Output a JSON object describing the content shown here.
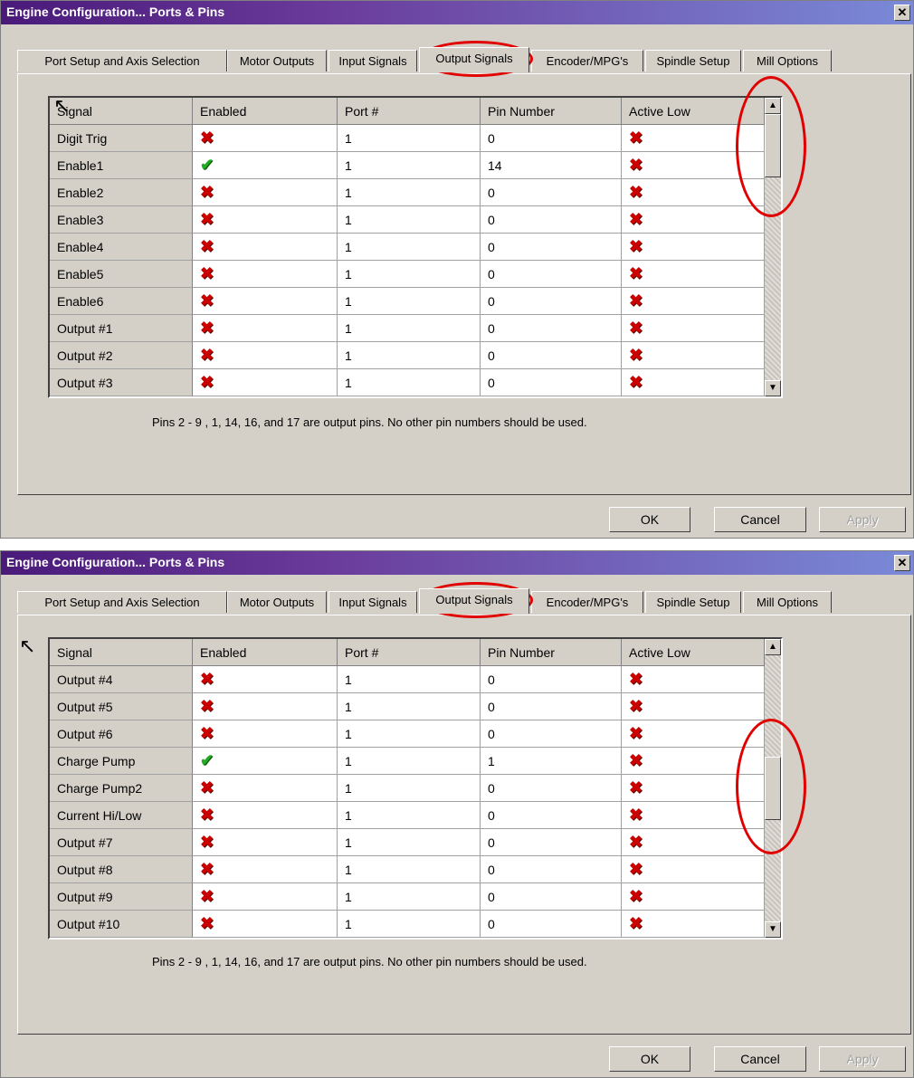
{
  "dialogs": [
    {
      "title": "Engine Configuration... Ports & Pins",
      "close_glyph": "✕",
      "tabs": [
        "Port Setup and Axis Selection",
        "Motor Outputs",
        "Input Signals",
        "Output Signals",
        "Encoder/MPG's",
        "Spindle Setup",
        "Mill Options"
      ],
      "active_tab": "Output Signals",
      "columns": [
        "Signal",
        "Enabled",
        "Port #",
        "Pin Number",
        "Active Low"
      ],
      "rows": [
        {
          "signal": "Digit  Trig",
          "enabled": "x",
          "port": "1",
          "pin": "0",
          "active_low": "x"
        },
        {
          "signal": "Enable1",
          "enabled": "check",
          "port": "1",
          "pin": "14",
          "active_low": "x"
        },
        {
          "signal": "Enable2",
          "enabled": "x",
          "port": "1",
          "pin": "0",
          "active_low": "x"
        },
        {
          "signal": "Enable3",
          "enabled": "x",
          "port": "1",
          "pin": "0",
          "active_low": "x"
        },
        {
          "signal": "Enable4",
          "enabled": "x",
          "port": "1",
          "pin": "0",
          "active_low": "x"
        },
        {
          "signal": "Enable5",
          "enabled": "x",
          "port": "1",
          "pin": "0",
          "active_low": "x"
        },
        {
          "signal": "Enable6",
          "enabled": "x",
          "port": "1",
          "pin": "0",
          "active_low": "x"
        },
        {
          "signal": "Output #1",
          "enabled": "x",
          "port": "1",
          "pin": "0",
          "active_low": "x"
        },
        {
          "signal": "Output #2",
          "enabled": "x",
          "port": "1",
          "pin": "0",
          "active_low": "x"
        },
        {
          "signal": "Output #3",
          "enabled": "x",
          "port": "1",
          "pin": "0",
          "active_low": "x"
        }
      ],
      "scroll_position": 0.0,
      "note": "Pins 2 - 9 , 1, 14, 16, and 17 are output pins. No  other pin numbers should be used.",
      "buttons": {
        "ok": "OK",
        "cancel": "Cancel",
        "apply": "Apply"
      }
    },
    {
      "title": "Engine Configuration... Ports & Pins",
      "close_glyph": "✕",
      "tabs": [
        "Port Setup and Axis Selection",
        "Motor Outputs",
        "Input Signals",
        "Output Signals",
        "Encoder/MPG's",
        "Spindle Setup",
        "Mill Options"
      ],
      "active_tab": "Output Signals",
      "columns": [
        "Signal",
        "Enabled",
        "Port #",
        "Pin Number",
        "Active Low"
      ],
      "rows": [
        {
          "signal": "Output #4",
          "enabled": "x",
          "port": "1",
          "pin": "0",
          "active_low": "x"
        },
        {
          "signal": "Output #5",
          "enabled": "x",
          "port": "1",
          "pin": "0",
          "active_low": "x"
        },
        {
          "signal": "Output #6",
          "enabled": "x",
          "port": "1",
          "pin": "0",
          "active_low": "x"
        },
        {
          "signal": "Charge Pump",
          "enabled": "check",
          "port": "1",
          "pin": "1",
          "active_low": "x"
        },
        {
          "signal": "Charge Pump2",
          "enabled": "x",
          "port": "1",
          "pin": "0",
          "active_low": "x"
        },
        {
          "signal": "Current Hi/Low",
          "enabled": "x",
          "port": "1",
          "pin": "0",
          "active_low": "x"
        },
        {
          "signal": "Output #7",
          "enabled": "x",
          "port": "1",
          "pin": "0",
          "active_low": "x"
        },
        {
          "signal": "Output #8",
          "enabled": "x",
          "port": "1",
          "pin": "0",
          "active_low": "x"
        },
        {
          "signal": "Output #9",
          "enabled": "x",
          "port": "1",
          "pin": "0",
          "active_low": "x"
        },
        {
          "signal": "Output #10",
          "enabled": "x",
          "port": "1",
          "pin": "0",
          "active_low": "x"
        }
      ],
      "scroll_position": 0.5,
      "note": "Pins 2 - 9 , 1, 14, 16, and 17 are output pins. No  other pin numbers should be used.",
      "buttons": {
        "ok": "OK",
        "cancel": "Cancel",
        "apply": "Apply"
      }
    }
  ],
  "icons": {
    "x": "red-x-icon",
    "check": "green-check-icon"
  },
  "colors": {
    "annotation": "#e00000",
    "title_start": "#4a1a7a",
    "title_end": "#7a8ad8"
  }
}
